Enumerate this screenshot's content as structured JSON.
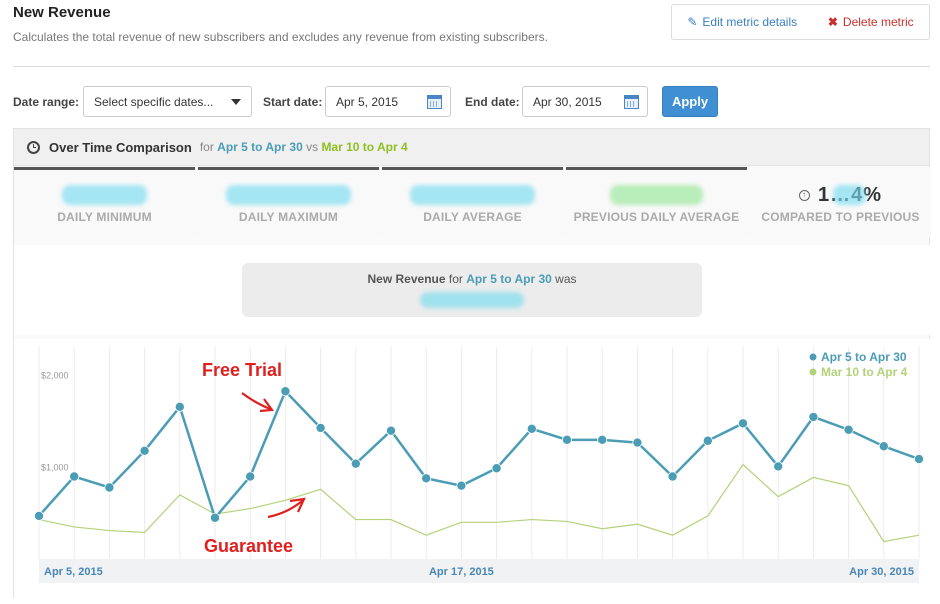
{
  "header": {
    "title": "New Revenue",
    "description": "Calculates the total revenue of new subscribers and excludes any revenue from existing subscribers."
  },
  "actions": {
    "edit_label": "Edit metric details",
    "delete_label": "Delete metric"
  },
  "filters": {
    "date_range_label": "Date range:",
    "date_range_value": "Select specific dates...",
    "start_label": "Start date:",
    "start_value": "Apr 5, 2015",
    "end_label": "End date:",
    "end_value": "Apr 30, 2015",
    "apply_label": "Apply"
  },
  "panel": {
    "title": "Over Time Comparison",
    "for_text": "for",
    "current_range": "Apr 5 to Apr 30",
    "vs_text": "vs",
    "previous_range": "Mar 10 to Apr 4"
  },
  "stats": [
    {
      "caption": "DAILY MINIMUM",
      "value": "",
      "blur_color": "cyan"
    },
    {
      "caption": "DAILY MAXIMUM",
      "value": "",
      "blur_color": "cyan"
    },
    {
      "caption": "DAILY AVERAGE",
      "value": "",
      "blur_color": "cyan"
    },
    {
      "caption": "PREVIOUS DAILY AVERAGE",
      "value": "",
      "blur_color": "green"
    },
    {
      "caption": "COMPARED TO PREVIOUS",
      "value": "1…4%",
      "blur_color": "cyan"
    }
  ],
  "summary": {
    "metric": "New Revenue",
    "for_text": "for",
    "range": "Apr 5 to Apr 30",
    "was_text": "was"
  },
  "annotations": {
    "free_trial": "Free Trial",
    "guarantee": "Guarantee"
  },
  "colors": {
    "current": "#4a9db5",
    "previous": "#b3d27a",
    "annotation": "#e0201f",
    "apply": "#3f8fd2"
  },
  "chart_data": {
    "type": "line",
    "x": [
      "Apr 5",
      "Apr 6",
      "Apr 7",
      "Apr 8",
      "Apr 9",
      "Apr 10",
      "Apr 11",
      "Apr 12",
      "Apr 13",
      "Apr 14",
      "Apr 15",
      "Apr 16",
      "Apr 17",
      "Apr 18",
      "Apr 19",
      "Apr 20",
      "Apr 21",
      "Apr 22",
      "Apr 23",
      "Apr 24",
      "Apr 25",
      "Apr 26",
      "Apr 27",
      "Apr 28",
      "Apr 29",
      "Apr 30"
    ],
    "x_tick_labels": [
      "Apr 5, 2015",
      "Apr 17, 2015",
      "Apr 30, 2015"
    ],
    "x_tick_indices": [
      0,
      12,
      25
    ],
    "y_tick_labels": [
      "$1,000",
      "$2,000"
    ],
    "y_tick_values": [
      1000,
      2000
    ],
    "ylim": [
      0,
      2400
    ],
    "grid": "vertical",
    "legend_position": "top-right",
    "series": [
      {
        "name": "Apr 5 to Apr 30",
        "values": [
          470,
          900,
          780,
          1180,
          1660,
          450,
          900,
          1830,
          1430,
          1040,
          1400,
          880,
          800,
          990,
          1420,
          1300,
          1300,
          1270,
          900,
          1290,
          1480,
          1010,
          1550,
          1410,
          1230,
          1090
        ]
      },
      {
        "name": "Mar 10 to Apr 4",
        "values": [
          430,
          350,
          310,
          290,
          700,
          490,
          550,
          640,
          760,
          430,
          430,
          260,
          400,
          400,
          430,
          410,
          330,
          380,
          260,
          470,
          1030,
          680,
          890,
          800,
          190,
          260
        ]
      }
    ]
  }
}
